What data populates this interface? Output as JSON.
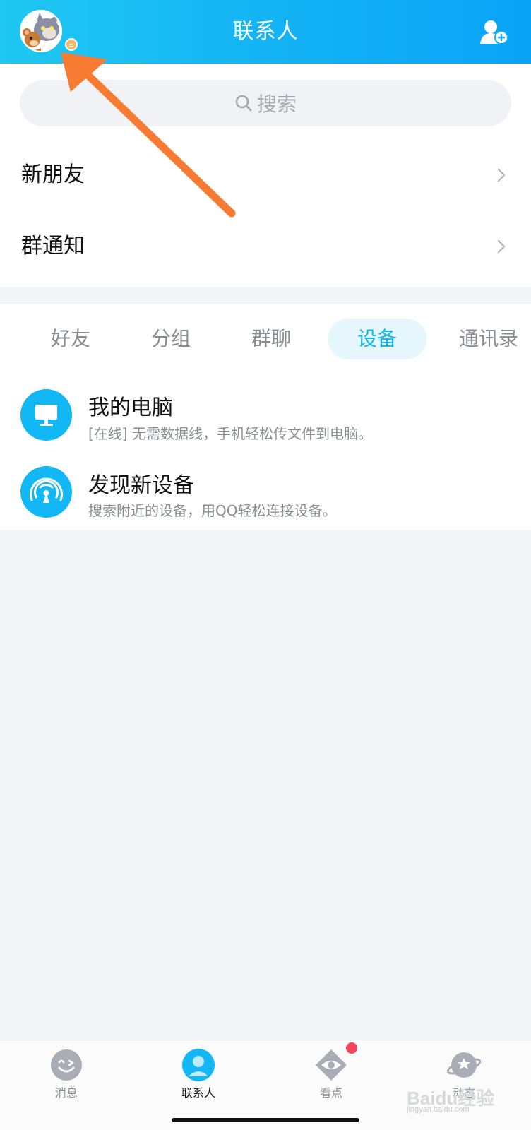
{
  "header": {
    "title": "联系人",
    "avatar_icon": "tom-and-jerry-avatar",
    "add_contact_icon": "add-contact-icon",
    "accent": "#12b7f5"
  },
  "search": {
    "placeholder": "搜索"
  },
  "quick_rows": [
    {
      "label": "新朋友"
    },
    {
      "label": "群通知"
    }
  ],
  "tabs": [
    {
      "label": "好友",
      "active": false
    },
    {
      "label": "分组",
      "active": false
    },
    {
      "label": "群聊",
      "active": false
    },
    {
      "label": "设备",
      "active": true
    },
    {
      "label": "通讯录",
      "active": false
    }
  ],
  "devices": [
    {
      "title": "我的电脑",
      "subtitle": "[在线] 无需数据线，手机轻松传文件到电脑。",
      "icon": "monitor-icon"
    },
    {
      "title": "发现新设备",
      "subtitle": "搜索附近的设备，用QQ轻松连接设备。",
      "icon": "radar-icon"
    }
  ],
  "tabbar": [
    {
      "label": "消息",
      "icon": "message-icon",
      "active": false
    },
    {
      "label": "联系人",
      "icon": "contacts-icon",
      "active": true
    },
    {
      "label": "看点",
      "icon": "eye-icon",
      "active": false,
      "badge": true
    },
    {
      "label": "动态",
      "icon": "planet-icon",
      "active": false
    }
  ],
  "watermark": {
    "text": "Baidu经验",
    "sub": "jingyan.baidu.com"
  }
}
